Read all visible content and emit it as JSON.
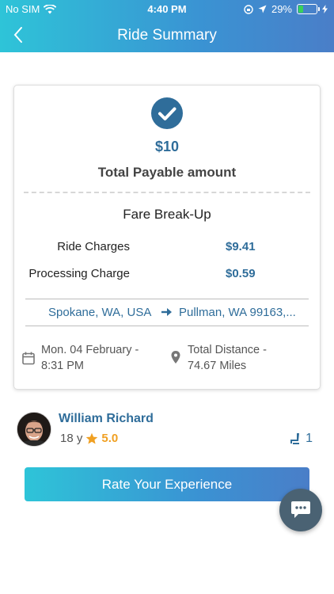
{
  "status_bar": {
    "carrier": "No SIM",
    "time": "4:40 PM",
    "battery": "29%",
    "battery_level": 0.29
  },
  "nav": {
    "title": "Ride Summary"
  },
  "summary": {
    "amount": "$10",
    "total_label": "Total Payable amount",
    "fare_title": "Fare Break-Up",
    "fares": [
      {
        "label": "Ride Charges",
        "value": "$9.41"
      },
      {
        "label": "Processing Charge",
        "value": "$0.59"
      }
    ],
    "route": {
      "from": "Spokane, WA, USA",
      "to": "Pullman, WA 99163,..."
    },
    "date": {
      "line1": "Mon. 04 February -",
      "line2": "8:31 PM"
    },
    "distance": {
      "line1": "Total Distance -",
      "line2": "74.67 Miles"
    }
  },
  "driver": {
    "name": "William Richard",
    "age": "18 y",
    "rating": "5.0",
    "seats": "1"
  },
  "actions": {
    "rate_label": "Rate Your Experience"
  },
  "colors": {
    "accent": "#2f6d9a",
    "star": "#f0a022",
    "gradient_start": "#2ec4d8",
    "gradient_end": "#4a7ec8"
  }
}
